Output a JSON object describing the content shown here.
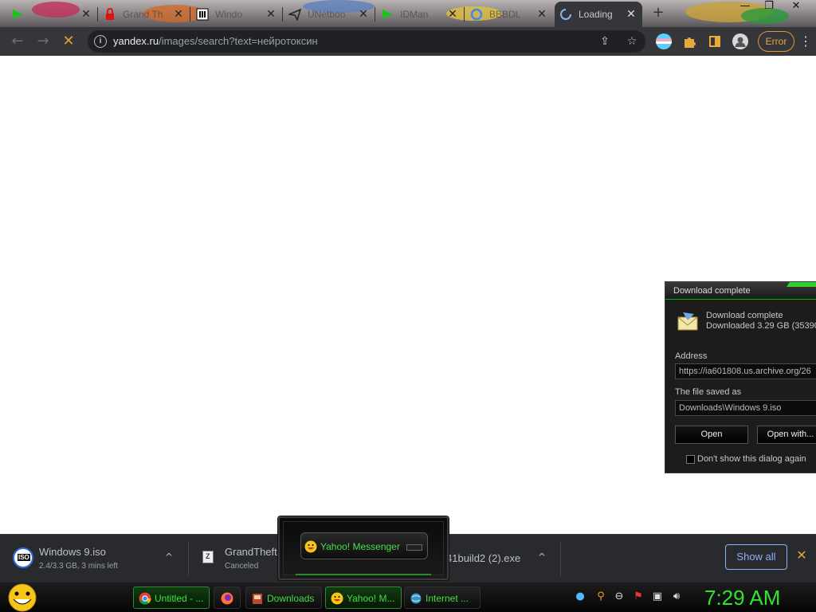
{
  "browser": {
    "tabs": [
      {
        "title": "",
        "icon": "idm-green-arrow-icon",
        "close": "✕"
      },
      {
        "title": "Grand Th",
        "icon": "lock-red-icon",
        "close": "✕"
      },
      {
        "title": "Windo",
        "icon": "archive-building-icon",
        "close": "✕"
      },
      {
        "title": "UNetboo",
        "icon": "send-plane-icon",
        "close": "✕"
      },
      {
        "title": "IDMan",
        "icon": "idm-green-arrow-icon",
        "close": "✕"
      },
      {
        "title": "BBBDL",
        "icon": "google-g-icon",
        "close": "✕"
      },
      {
        "title": "Loading",
        "icon": "loading-spinner-icon",
        "close": "✕",
        "active": true
      }
    ],
    "new_tab": "+",
    "window_controls": {
      "minimize": "—",
      "maximize": "❐",
      "close": "✕"
    },
    "toolbar": {
      "back": "←",
      "forward": "→",
      "stop": "✕",
      "url_host": "yandex.ru",
      "url_path": "/images/search?text=нейротоксин",
      "info_icon": "i",
      "share_icon": "⇪",
      "star_icon": "☆",
      "error_label": "Error",
      "menu": "⋮"
    }
  },
  "download_dialog": {
    "title": "Download complete",
    "heading": "Download complete",
    "downloaded": "Downloaded 3.29  GB (35390",
    "address_label": "Address",
    "address_value": "https://ia601808.us.archive.org/26",
    "saved_label": "The file saved as",
    "saved_value": "Downloads\\Windows 9.iso",
    "open_button": "Open",
    "open_with_button": "Open with...",
    "dont_show": "Don't show this dialog again"
  },
  "download_shelf": {
    "items": [
      {
        "name": "Windows 9.iso",
        "status": "2.4/3.3 GB, 3 mins left",
        "icon": "iso-file-icon"
      },
      {
        "name": "GrandTheftA",
        "status": "Canceled",
        "icon": "zip-file-icon"
      },
      {
        "name": "41build2 (2).exe",
        "status": ""
      }
    ],
    "chevron": "^",
    "show_all": "Show all",
    "close": "✕"
  },
  "yahoo_popup": {
    "label": "Yahoo! Messenger"
  },
  "taskbar": {
    "buttons": [
      {
        "label": "Untitled - ...",
        "icon": "chrome-icon",
        "active": true
      },
      {
        "label": "",
        "icon": "firefox-icon"
      },
      {
        "label": "Downloads",
        "icon": "downloads-folder-icon"
      },
      {
        "label": "Yahoo! M...",
        "icon": "yahoo-smiley-icon",
        "active": true
      },
      {
        "label": "Internet ...",
        "icon": "internet-globe-icon"
      }
    ],
    "clock": "7:29 AM"
  },
  "colors": {
    "accent_green": "#2ee52e",
    "error_orange": "#f0a040",
    "link_blue": "#8ab4f8",
    "toolbar_bg": "#35363a"
  }
}
